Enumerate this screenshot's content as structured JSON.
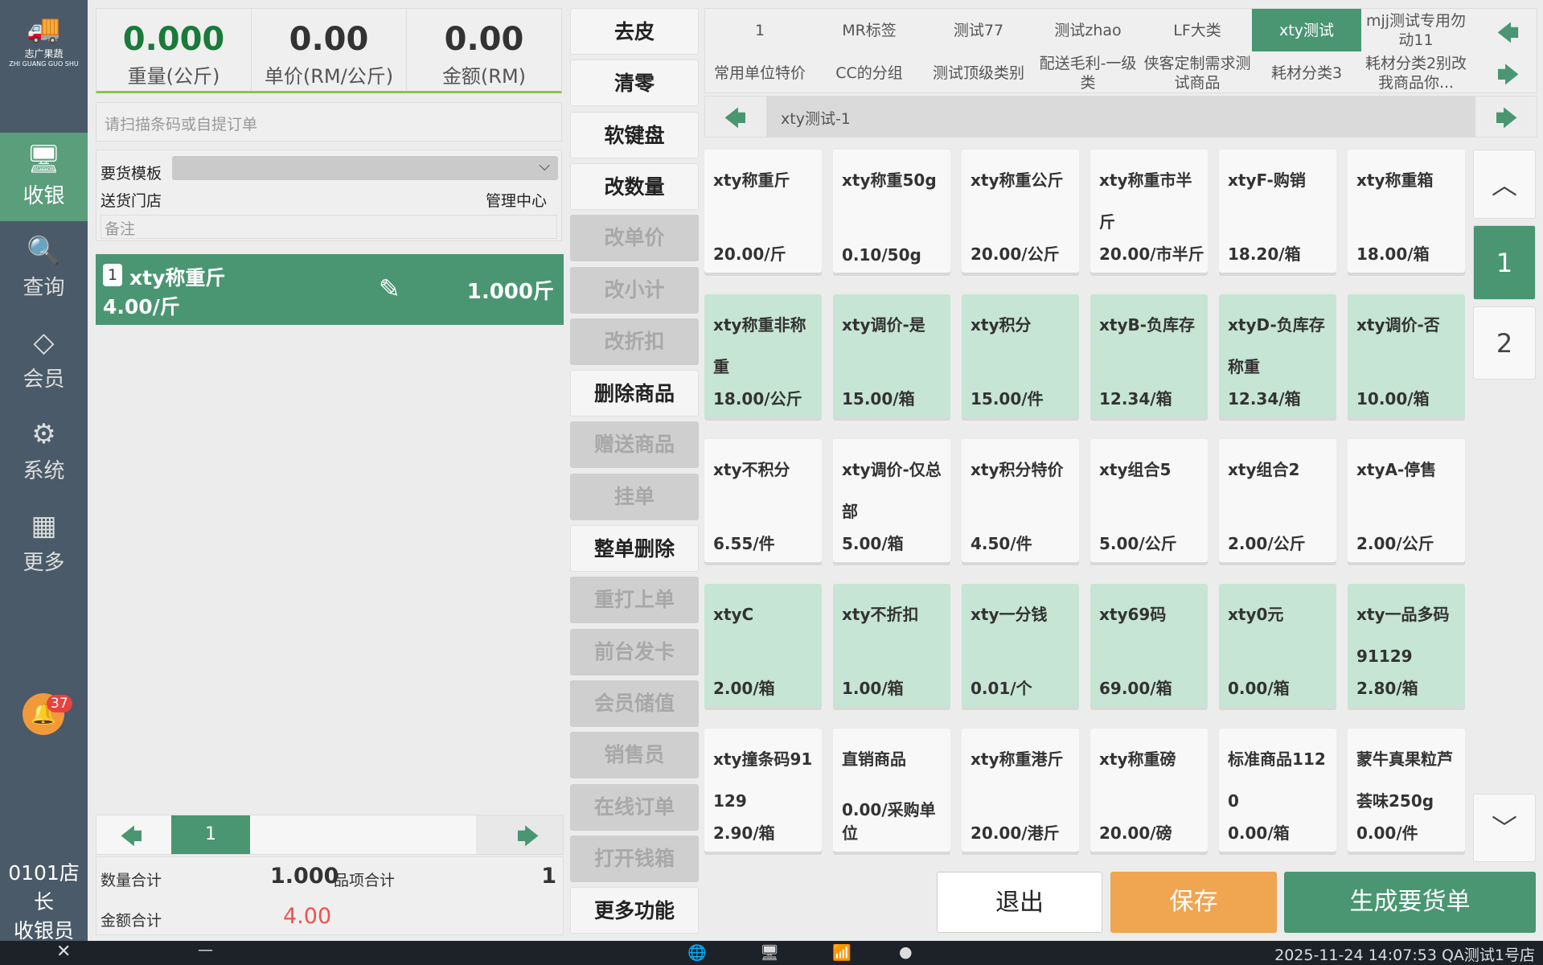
{
  "sidebar": {
    "logo_text": "志广果蔬",
    "logo_sub": "ZHI GUANG GUO SHU",
    "items": [
      {
        "label": "收银",
        "icon": "cashier-icon"
      },
      {
        "label": "查询",
        "icon": "search-doc-icon"
      },
      {
        "label": "会员",
        "icon": "diamond-icon"
      },
      {
        "label": "系统",
        "icon": "gear-icon"
      },
      {
        "label": "更多",
        "icon": "grid-icon"
      }
    ],
    "notification_count": "37",
    "user_line1": "0101店长",
    "user_line2": "收银员"
  },
  "scale": {
    "weight": "0.000",
    "weight_label": "重量(公斤)",
    "unit_price": "0.00",
    "unit_price_label": "单价(RM/公斤)",
    "amount": "0.00",
    "amount_label": "金额(RM)"
  },
  "scan_placeholder": "请扫描条码或自提订单",
  "order_form": {
    "template_label": "要货模板",
    "template_value": "",
    "store_label": "送货门店",
    "store_value": "管理中心",
    "note_placeholder": "备注"
  },
  "cart": {
    "items": [
      {
        "index": "1",
        "name": "xty称重斤",
        "price": "4.00/斤",
        "qty": "1.000斤"
      }
    ],
    "page": "1"
  },
  "totals": {
    "qty_label": "数量合计",
    "qty": "1.000",
    "items_label": "品项合计",
    "items": "1",
    "amount_label": "金额合计",
    "amount": "4.00"
  },
  "functions": [
    {
      "label": "去皮",
      "enabled": true
    },
    {
      "label": "清零",
      "enabled": true
    },
    {
      "label": "软键盘",
      "enabled": true
    },
    {
      "label": "改数量",
      "enabled": true
    },
    {
      "label": "改单价",
      "enabled": false
    },
    {
      "label": "改小计",
      "enabled": false
    },
    {
      "label": "改折扣",
      "enabled": false
    },
    {
      "label": "删除商品",
      "enabled": true
    },
    {
      "label": "赠送商品",
      "enabled": false
    },
    {
      "label": "挂单",
      "enabled": false
    },
    {
      "label": "整单删除",
      "enabled": true
    },
    {
      "label": "重打上单",
      "enabled": false
    },
    {
      "label": "前台发卡",
      "enabled": false
    },
    {
      "label": "会员储值",
      "enabled": false
    },
    {
      "label": "销售员",
      "enabled": false
    },
    {
      "label": "在线订单",
      "enabled": false
    },
    {
      "label": "打开钱箱",
      "enabled": false
    },
    {
      "label": "更多功能",
      "enabled": true
    }
  ],
  "categories": [
    [
      "1",
      "MR标签",
      "测试77",
      "测试zhao",
      "LF大类",
      "xty测试",
      "mjj测试专用勿动11"
    ],
    [
      "常用单位特价",
      "CC的分组",
      "测试顶级类别",
      "配送毛利-一级类",
      "侠客定制需求测试商品",
      "耗材分类3",
      "耗材分类2别改我商品你..."
    ]
  ],
  "active_category": "xty测试",
  "subcategory": "xty测试-1",
  "products": [
    {
      "name": "xty称重斤",
      "price": "20.00/斤",
      "green": false
    },
    {
      "name": "xty称重50g",
      "price": "0.10/50g",
      "green": false
    },
    {
      "name": "xty称重公斤",
      "price": "20.00/公斤",
      "green": false
    },
    {
      "name": "xty称重市半斤",
      "price": "20.00/市半斤",
      "green": false
    },
    {
      "name": "xtyF-购销",
      "price": "18.20/箱",
      "green": false
    },
    {
      "name": "xty称重箱",
      "price": "18.00/箱",
      "green": false
    },
    {
      "name": "xty称重非称重",
      "price": "18.00/公斤",
      "green": true
    },
    {
      "name": "xty调价-是",
      "price": "15.00/箱",
      "green": true
    },
    {
      "name": "xty积分",
      "price": "15.00/件",
      "green": true
    },
    {
      "name": "xtyB-负库存",
      "price": "12.34/箱",
      "green": true
    },
    {
      "name": "xtyD-负库存称重",
      "price": "12.34/箱",
      "green": true
    },
    {
      "name": "xty调价-否",
      "price": "10.00/箱",
      "green": true
    },
    {
      "name": "xty不积分",
      "price": "6.55/件",
      "green": false
    },
    {
      "name": "xty调价-仅总部",
      "price": "5.00/箱",
      "green": false
    },
    {
      "name": "xty积分特价",
      "price": "4.50/件",
      "green": false
    },
    {
      "name": "xty组合5",
      "price": "5.00/公斤",
      "green": false
    },
    {
      "name": "xty组合2",
      "price": "2.00/公斤",
      "green": false
    },
    {
      "name": "xtyA-停售",
      "price": "2.00/公斤",
      "green": false
    },
    {
      "name": "xtyC",
      "price": "2.00/箱",
      "green": true
    },
    {
      "name": "xty不折扣",
      "price": "1.00/箱",
      "green": true
    },
    {
      "name": "xty一分钱",
      "price": "0.01/个",
      "green": true
    },
    {
      "name": "xty69码",
      "price": "69.00/箱",
      "green": true
    },
    {
      "name": "xty0元",
      "price": "0.00/箱",
      "green": true
    },
    {
      "name": "xty一品多码91129",
      "price": "2.80/箱",
      "green": true
    },
    {
      "name": "xty撞条码91129",
      "price": "2.90/箱",
      "green": false
    },
    {
      "name": "直销商品",
      "price": "0.00/采购单位",
      "green": false
    },
    {
      "name": "xty称重港斤",
      "price": "20.00/港斤",
      "green": false
    },
    {
      "name": "xty称重磅",
      "price": "20.00/磅",
      "green": false
    },
    {
      "name": "标准商品1120",
      "price": "0.00/箱",
      "green": false
    },
    {
      "name": "蒙牛真果粒芦荟味250g",
      "price": "0.00/件",
      "green": false
    }
  ],
  "product_pages": [
    "1",
    "2"
  ],
  "actions": {
    "exit": "退出",
    "save": "保存",
    "generate": "生成要货单"
  },
  "statusbar": {
    "datetime": "2025-11-24 14:07:53",
    "store": "QA测试1号店"
  },
  "colors": {
    "accent": "#4a9672",
    "save": "#f0a550",
    "amount_red": "#f05050",
    "weight_green": "#1a7a3a"
  }
}
